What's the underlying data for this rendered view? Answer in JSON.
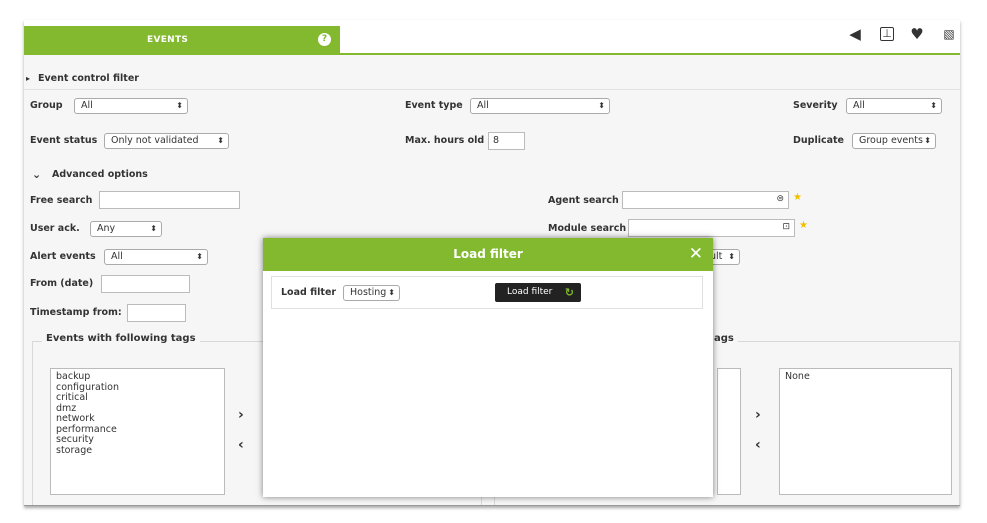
{
  "tab": {
    "label": "EVENTS",
    "help_icon": "?"
  },
  "top_icons": [
    "sound-icon",
    "screen-icon",
    "heart-icon",
    "rss-icon"
  ],
  "section": {
    "title": "Event control filter"
  },
  "filters": {
    "group_label": "Group",
    "group_value": "All",
    "event_type_label": "Event type",
    "event_type_value": "All",
    "severity_label": "Severity",
    "severity_value": "All",
    "event_status_label": "Event status",
    "event_status_value": "Only not validated",
    "max_hours_label": "Max. hours old",
    "max_hours_value": "8",
    "duplicate_label": "Duplicate",
    "duplicate_value": "Group events"
  },
  "advanced": {
    "title": "Advanced options",
    "free_search_label": "Free search",
    "agent_search_label": "Agent search",
    "user_ack_label": "User ack.",
    "user_ack_value": "Any",
    "module_search_label": "Module search",
    "alert_events_label": "Alert events",
    "alert_events_value": "All",
    "partial_hidden_select": "ult",
    "from_date_label": "From (date)",
    "timestamp_from_label": "Timestamp from:"
  },
  "tags": {
    "with_title": "Events with following tags",
    "without_title_partial": "ags",
    "available": [
      "backup",
      "configuration",
      "critical",
      "dmz",
      "network",
      "performance",
      "security",
      "storage"
    ],
    "selected_right": [
      "None"
    ],
    "arrow_right": "›",
    "arrow_left": "‹"
  },
  "modal": {
    "title": "Load filter",
    "row_label": "Load filter",
    "select_value": "Hosting",
    "button_label": "Load filter",
    "close": "✕"
  },
  "colors": {
    "accent": "#82b92e",
    "button_dark": "#222222",
    "star": "#f0c000"
  }
}
